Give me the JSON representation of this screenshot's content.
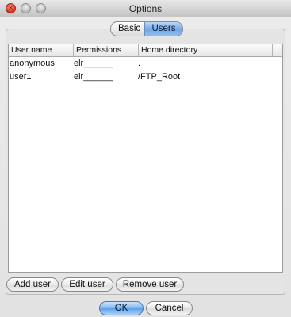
{
  "window": {
    "title": "Options",
    "controls": {
      "close_glyph": "×"
    }
  },
  "tabs": [
    {
      "label": "Basic",
      "selected": false
    },
    {
      "label": "Users",
      "selected": true
    }
  ],
  "users_table": {
    "columns": [
      "User name",
      "Permissions",
      "Home directory",
      ""
    ],
    "rows": [
      {
        "user": "anonymous",
        "permissions": "elr______",
        "home": "."
      },
      {
        "user": "user1",
        "permissions": "elr______",
        "home": "/FTP_Root"
      }
    ]
  },
  "actions": {
    "add_user": "Add user",
    "edit_user": "Edit user",
    "remove_user": "Remove user"
  },
  "dialog_buttons": {
    "ok": "OK",
    "cancel": "Cancel"
  },
  "colors": {
    "accent": "#6fa9e8",
    "close_button": "#d9301f"
  }
}
